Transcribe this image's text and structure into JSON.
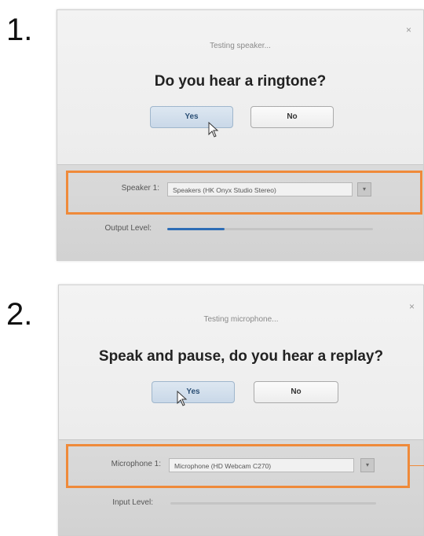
{
  "step1": {
    "number": "1.",
    "close": "×",
    "status": "Testing speaker...",
    "question": "Do you hear a ringtone?",
    "yes_label": "Yes",
    "no_label": "No",
    "device_label": "Speaker 1:",
    "device_value": "Speakers (HK Onyx Studio Stereo)",
    "level_label": "Output Level:",
    "level_fraction": 0.28
  },
  "step2": {
    "number": "2.",
    "close": "×",
    "status": "Testing microphone...",
    "question": "Speak and pause, do you hear a replay?",
    "yes_label": "Yes",
    "no_label": "No",
    "device_label": "Microphone 1:",
    "device_value": "Microphone (HD Webcam C270)",
    "level_label": "Input Level:",
    "level_fraction": 0
  },
  "colors": {
    "highlight": "#ef8a3a",
    "level_fill": "#2d6db5"
  }
}
